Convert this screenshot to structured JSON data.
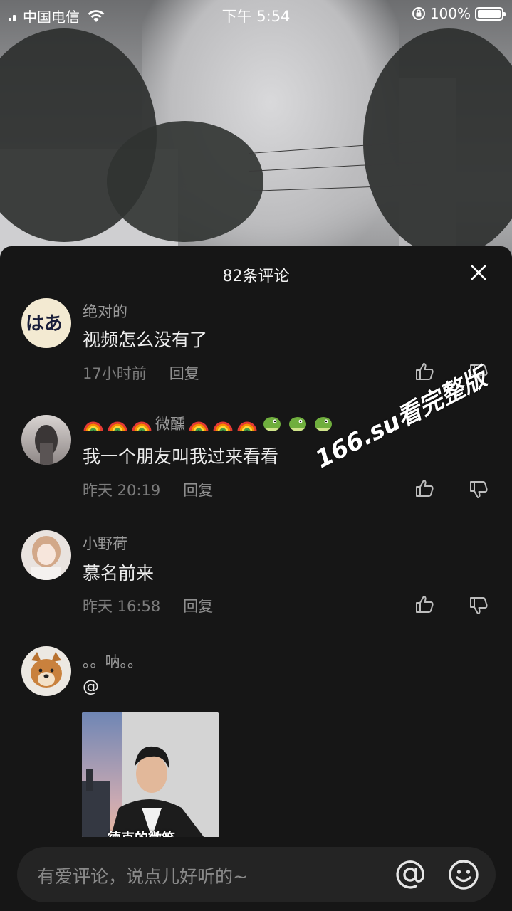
{
  "status_bar": {
    "carrier": "中国电信",
    "time": "下午 5:54",
    "battery": "100%"
  },
  "panel": {
    "title": "82条评论"
  },
  "comments": [
    {
      "name": "绝对的",
      "text": "视频怎么没有了",
      "time": "17小时前",
      "reply": "回复"
    },
    {
      "name": "微醺",
      "text": "我一个朋友叫我过来看看",
      "time": "昨天 20:19",
      "reply": "回复"
    },
    {
      "name": "小野荷",
      "text": "慕名前来",
      "time": "昨天 16:58",
      "reply": "回复"
    },
    {
      "name": "。。呐。。",
      "text": "@",
      "preview_caption": "德克的微笑"
    }
  ],
  "watermark": "166.su看完整版",
  "input": {
    "placeholder": "有爱评论，说点儿好听的~"
  }
}
